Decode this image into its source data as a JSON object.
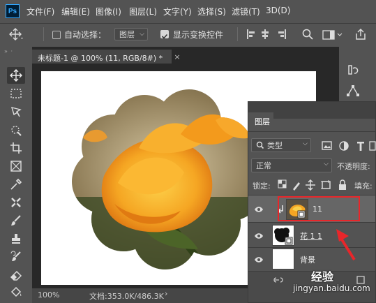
{
  "menubar": {
    "logo": "Ps",
    "items": [
      "文件(F)",
      "编辑(E)",
      "图像(I)",
      "图层(L)",
      "文字(Y)",
      "选择(S)",
      "滤镜(T)",
      "3D(D)"
    ]
  },
  "options": {
    "auto_select_label": "自动选择：",
    "auto_select_target": "图层",
    "show_transform_label": "显示变换控件"
  },
  "document": {
    "tab_label": "未标题-1 @ 100% (11, RGB/8#) *",
    "zoom": "100%",
    "doc_size": "文档:353.0K/486.3K"
  },
  "layers_panel": {
    "title": "图层",
    "filter_kind": "类型",
    "blend_mode": "正常",
    "opacity_label": "不透明度:",
    "lock_label": "锁定:",
    "fill_label": "填充:",
    "layers": [
      {
        "name": "11",
        "selected": true
      },
      {
        "name": "花 1 1",
        "selected": false
      },
      {
        "name": "背景",
        "selected": false
      }
    ]
  },
  "watermark": {
    "line1": "经验",
    "line2": "jingyan.baidu.com"
  },
  "colors": {
    "ui_panel": "#535353",
    "highlight_box": "#e8262a",
    "arrow": "#e8262a",
    "flower_orange": "#f5a623"
  }
}
